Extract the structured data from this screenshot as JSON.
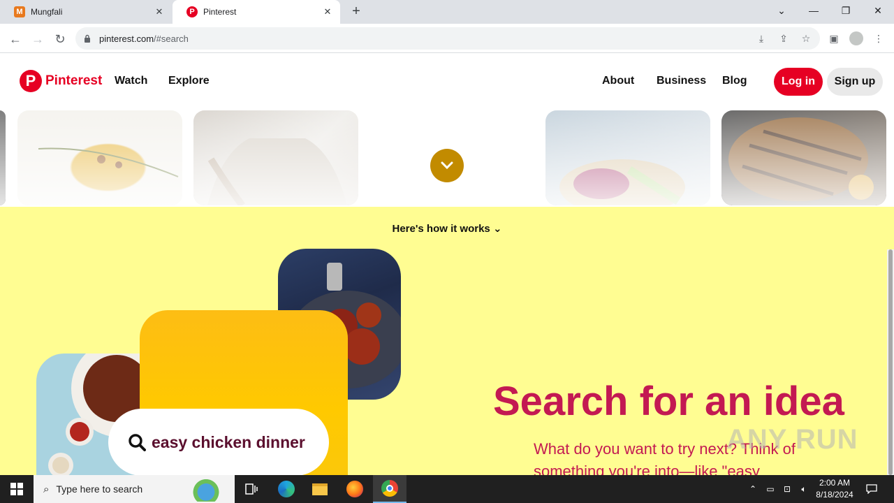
{
  "browser": {
    "tabs": [
      {
        "title": "Mungfali",
        "favicon": "mungfali-favicon",
        "active": false
      },
      {
        "title": "Pinterest",
        "favicon": "pinterest-favicon",
        "active": true
      }
    ],
    "url_host": "pinterest.com",
    "url_path": "/#search"
  },
  "header": {
    "logo_text": "Pinterest",
    "nav_left": [
      "Watch",
      "Explore"
    ],
    "nav_right": [
      "About",
      "Business",
      "Blog"
    ],
    "login_label": "Log in",
    "signup_label": "Sign up"
  },
  "how_it_works": "Here's how it works",
  "hero": {
    "search_text": "easy chicken dinner",
    "headline": "Search for an idea",
    "subtext": "What do you want to try next? Think of something you're into—like \"easy"
  },
  "watermark": "ANY RUN",
  "taskbar": {
    "search_placeholder": "Type here to search",
    "time": "2:00 AM",
    "date": "8/18/2024"
  },
  "colors": {
    "brand": "#e60023",
    "headline": "#c31952",
    "yellow_bg": "#fffd92"
  }
}
